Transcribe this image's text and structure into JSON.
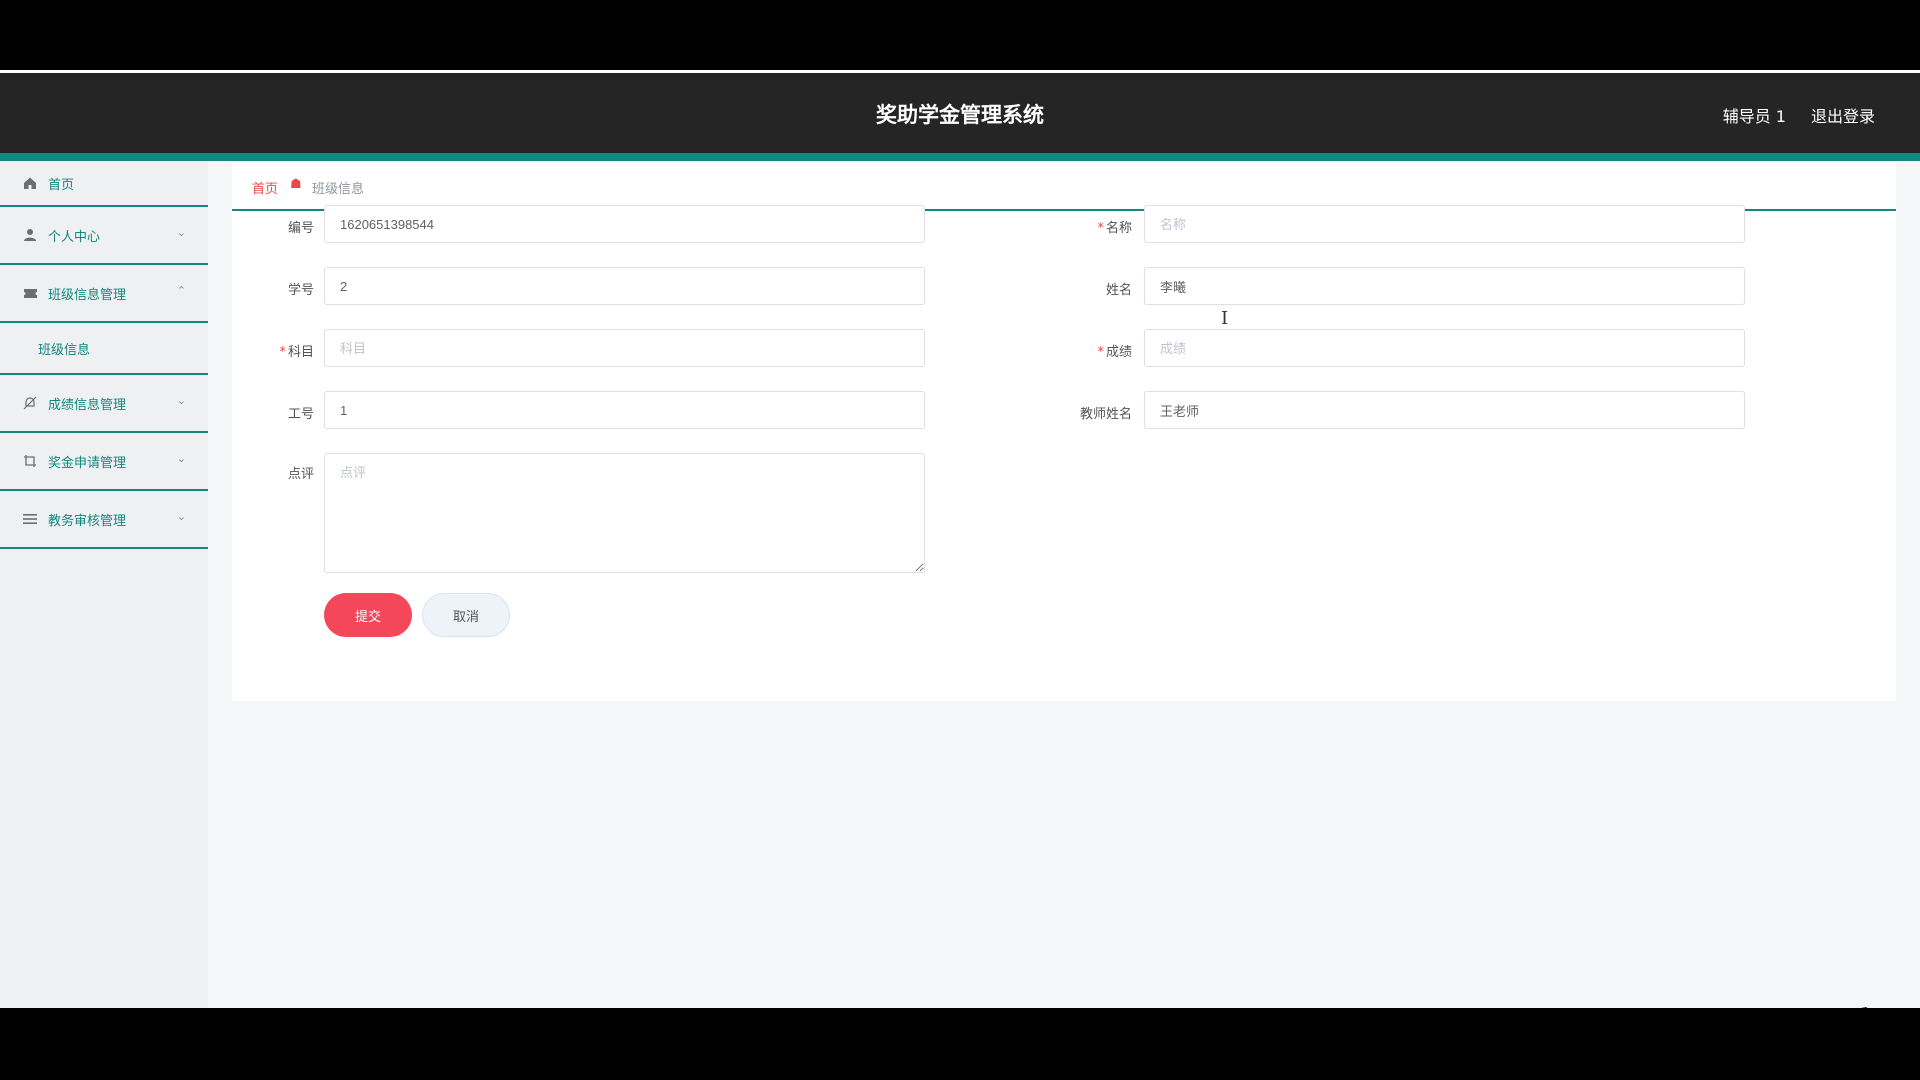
{
  "header": {
    "title": "奖助学金管理系统",
    "user": "辅导员 1",
    "logout": "退出登录"
  },
  "sidebar": {
    "items": [
      {
        "label": "首页"
      },
      {
        "label": "个人中心"
      },
      {
        "label": "班级信息管理"
      },
      {
        "label": "成绩信息管理"
      },
      {
        "label": "奖金申请管理"
      },
      {
        "label": "教务审核管理"
      }
    ],
    "sub_label": "班级信息"
  },
  "breadcrumb": {
    "home": "首页",
    "current": "班级信息"
  },
  "form": {
    "bianhao": {
      "label": "编号",
      "value": "1620651398544"
    },
    "mingcheng": {
      "label": "名称",
      "placeholder": "名称"
    },
    "xuehao": {
      "label": "学号",
      "value": "2"
    },
    "xingming": {
      "label": "姓名",
      "value": "李曦"
    },
    "kemu": {
      "label": "科目",
      "placeholder": "科目"
    },
    "chengji": {
      "label": "成绩",
      "placeholder": "成绩"
    },
    "gonghao": {
      "label": "工号",
      "value": "1"
    },
    "jiaoshi": {
      "label": "教师姓名",
      "value": "王老师"
    },
    "dianping": {
      "label": "点评",
      "placeholder": "点评"
    },
    "submit": "提交",
    "cancel": "取消"
  }
}
